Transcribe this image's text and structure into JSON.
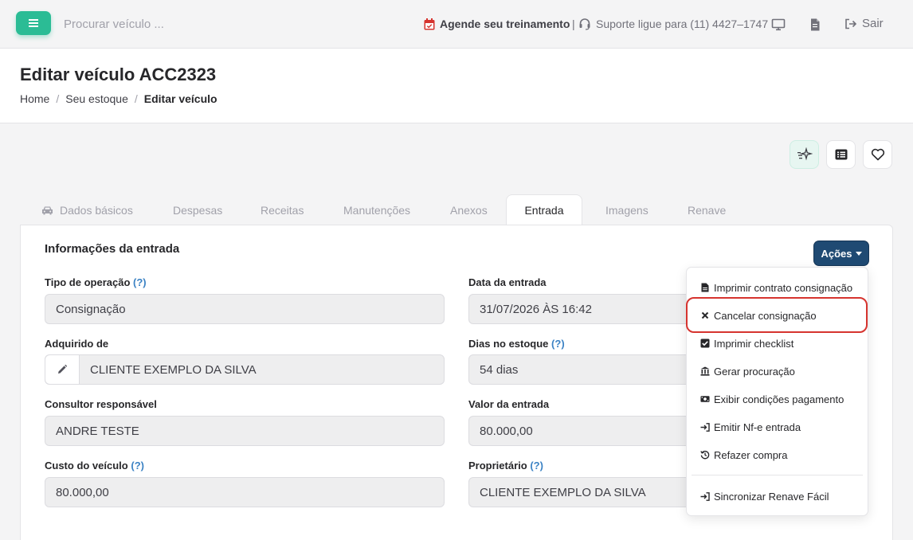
{
  "topbar": {
    "search_placeholder": "Procurar veículo ...",
    "schedule_label": "Agende seu treinamento",
    "separator": "|",
    "support_label": "Suporte ligue para (11) 4427–1747",
    "exit_label": "Sair"
  },
  "header": {
    "title": "Editar veículo ACC2323",
    "breadcrumb": [
      "Home",
      "Seu estoque",
      "Editar veículo"
    ],
    "breadcrumb_sep": "/"
  },
  "tabs": [
    "Dados básicos",
    "Despesas",
    "Receitas",
    "Manutenções",
    "Anexos",
    "Entrada",
    "Imagens",
    "Renave"
  ],
  "active_tab": "Entrada",
  "card": {
    "title": "Informações da entrada",
    "actions_label": "Ações"
  },
  "fields": {
    "help_mark": "(?)",
    "tipo_operacao": {
      "label": "Tipo de operação",
      "value": "Consignação"
    },
    "data_entrada": {
      "label": "Data da entrada",
      "value": "31/07/2026 ÀS 16:42"
    },
    "adquirido_de": {
      "label": "Adquirido de",
      "value": "CLIENTE EXEMPLO DA SILVA"
    },
    "dias_estoque": {
      "label": "Dias no estoque",
      "value": "54 dias"
    },
    "consultor": {
      "label": "Consultor responsável",
      "value": "ANDRE TESTE"
    },
    "valor_entrada": {
      "label": "Valor da entrada",
      "value": "80.000,00"
    },
    "custo_veiculo": {
      "label": "Custo do veículo",
      "value": "80.000,00"
    },
    "proprietario": {
      "label": "Proprietário",
      "value": "CLIENTE EXEMPLO DA SILVA"
    }
  },
  "actions_menu": [
    {
      "label": "Imprimir contrato consignação",
      "icon": "file-icon"
    },
    {
      "label": "Cancelar consignação",
      "icon": "close-icon"
    },
    {
      "label": "Imprimir checklist",
      "icon": "checkbox-icon"
    },
    {
      "label": "Gerar procuração",
      "icon": "bank-icon"
    },
    {
      "label": "Exibir condições pagamento",
      "icon": "money-icon"
    },
    {
      "label": "Emitir Nf-e entrada",
      "icon": "sign-in-icon"
    },
    {
      "label": "Refazer compra",
      "icon": "history-icon"
    },
    {
      "label": "Sincronizar Renave Fácil",
      "icon": "sign-in-icon"
    }
  ],
  "colors": {
    "accent": "#2bbc95",
    "actions_button": "#1f4a73",
    "highlight": "#d6342f",
    "help": "#3b82c4"
  }
}
